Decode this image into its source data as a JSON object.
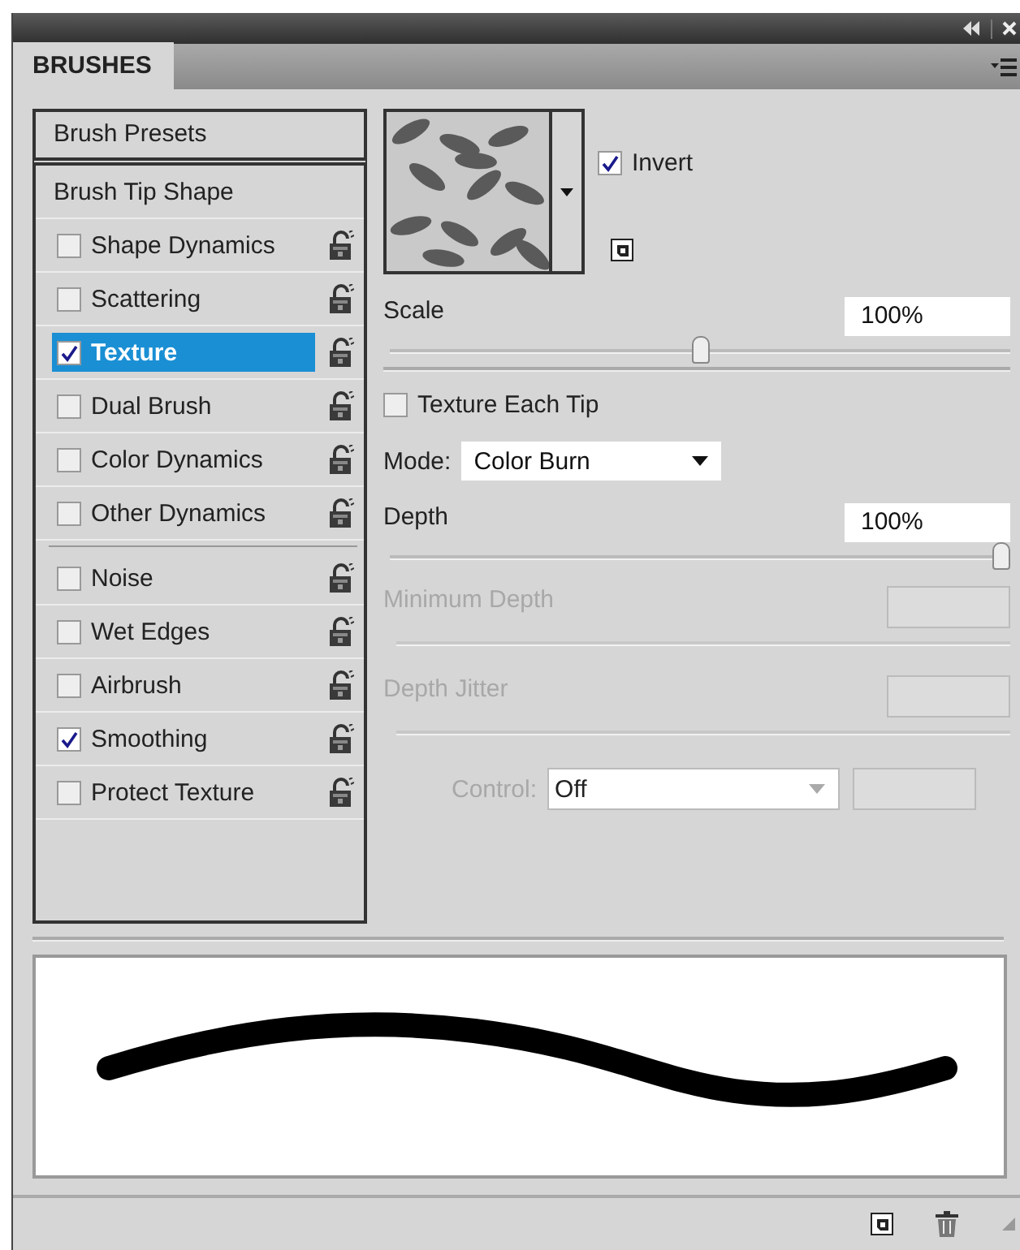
{
  "panel": {
    "tab": "BRUSHES"
  },
  "sidebar": {
    "sections": [
      {
        "items": [
          {
            "kind": "button",
            "label": "Brush Presets",
            "selected": false
          }
        ]
      },
      {
        "items": [
          {
            "kind": "plain",
            "label": "Brush Tip Shape",
            "selected": false
          },
          {
            "kind": "option",
            "label": "Shape Dynamics",
            "checked": false,
            "selected": false
          },
          {
            "kind": "option",
            "label": "Scattering",
            "checked": false,
            "selected": false
          },
          {
            "kind": "option",
            "label": "Texture",
            "checked": true,
            "selected": true
          },
          {
            "kind": "option",
            "label": "Dual Brush",
            "checked": false,
            "selected": false
          },
          {
            "kind": "option",
            "label": "Color Dynamics",
            "checked": false,
            "selected": false
          },
          {
            "kind": "option",
            "label": "Other Dynamics",
            "checked": false,
            "selected": false
          }
        ]
      },
      {
        "items": [
          {
            "kind": "option",
            "label": "Noise",
            "checked": false,
            "selected": false
          },
          {
            "kind": "option",
            "label": "Wet Edges",
            "checked": false,
            "selected": false
          },
          {
            "kind": "option",
            "label": "Airbrush",
            "checked": false,
            "selected": false
          },
          {
            "kind": "option",
            "label": "Smoothing",
            "checked": true,
            "selected": false
          },
          {
            "kind": "option",
            "label": "Protect Texture",
            "checked": false,
            "selected": false
          }
        ]
      }
    ]
  },
  "texture": {
    "invert": {
      "label": "Invert",
      "checked": true
    }
  },
  "scale": {
    "label": "Scale",
    "value": "100%",
    "level": 0.5,
    "disabled": false
  },
  "texture_each_tip": {
    "label": "Texture Each Tip",
    "checked": false
  },
  "mode": {
    "label": "Mode:",
    "value": "Color Burn"
  },
  "depth": {
    "label": "Depth",
    "value": "100%",
    "level": 1,
    "disabled": false
  },
  "minimum_depth": {
    "label": "Minimum Depth",
    "disabled": true
  },
  "depth_jitter": {
    "label": "Depth Jitter",
    "disabled": true
  },
  "control": {
    "label": "Control:",
    "value": "Off",
    "disabled": true
  }
}
